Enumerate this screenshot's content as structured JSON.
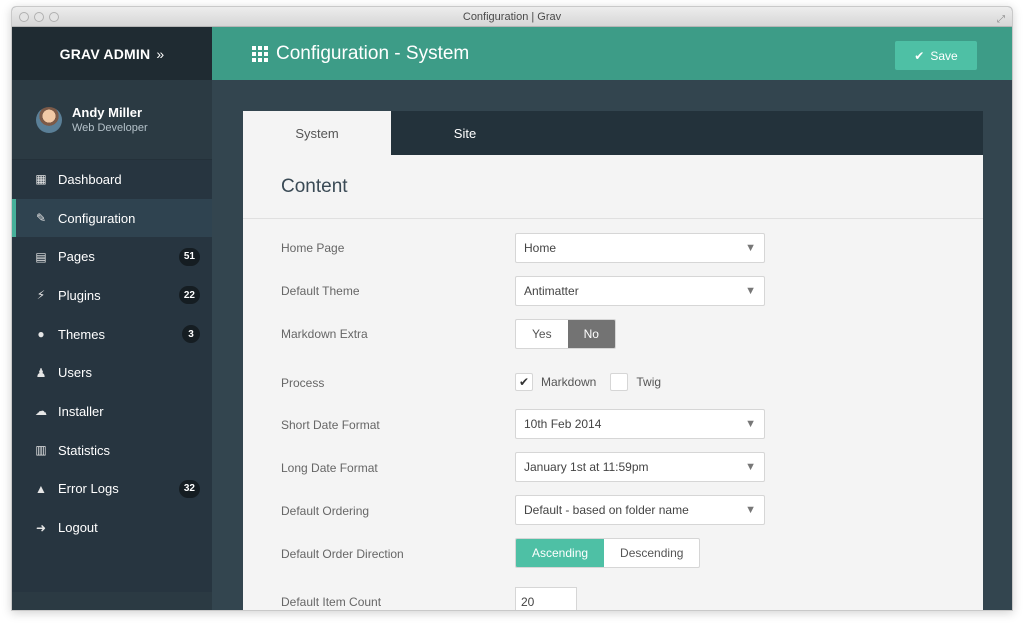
{
  "window": {
    "title": "Configuration | Grav"
  },
  "sidebar": {
    "brand": "GRAV ADMIN",
    "brand_chevron": "»",
    "user": {
      "name": "Andy Miller",
      "role": "Web Developer"
    },
    "items": [
      {
        "label": "Dashboard",
        "icon": "dashboard-grid-icon",
        "glyph": "▦",
        "badge": ""
      },
      {
        "label": "Configuration",
        "icon": "wrench-icon",
        "glyph": "✎",
        "badge": "",
        "active": true
      },
      {
        "label": "Pages",
        "icon": "file-icon",
        "glyph": "▤",
        "badge": "51"
      },
      {
        "label": "Plugins",
        "icon": "plug-icon",
        "glyph": "⚡",
        "badge": "22"
      },
      {
        "label": "Themes",
        "icon": "tint-icon",
        "glyph": "●",
        "badge": "3"
      },
      {
        "label": "Users",
        "icon": "user-icon",
        "glyph": "♟",
        "badge": ""
      },
      {
        "label": "Installer",
        "icon": "cloud-download-icon",
        "glyph": "☁",
        "badge": ""
      },
      {
        "label": "Statistics",
        "icon": "bar-chart-icon",
        "glyph": "▥",
        "badge": ""
      },
      {
        "label": "Error Logs",
        "icon": "warning-icon",
        "glyph": "▲",
        "badge": "32"
      },
      {
        "label": "Logout",
        "icon": "sign-out-icon",
        "glyph": "➜",
        "badge": ""
      }
    ]
  },
  "header": {
    "title": "Configuration - System",
    "save_label": "Save"
  },
  "tabs": [
    {
      "label": "System",
      "active": true
    },
    {
      "label": "Site",
      "active": false
    }
  ],
  "content": {
    "section_title": "Content",
    "home_page": {
      "label": "Home Page",
      "value": "Home"
    },
    "default_theme": {
      "label": "Default Theme",
      "value": "Antimatter"
    },
    "markdown_extra": {
      "label": "Markdown Extra",
      "yes": "Yes",
      "no": "No",
      "selected": "No"
    },
    "process": {
      "label": "Process",
      "markdown": "Markdown",
      "markdown_checked": true,
      "twig": "Twig",
      "twig_checked": false
    },
    "short_date": {
      "label": "Short Date Format",
      "value": "10th Feb 2014"
    },
    "long_date": {
      "label": "Long Date Format",
      "value": "January 1st at 11:59pm"
    },
    "ordering": {
      "label": "Default Ordering",
      "value": "Default - based on folder name"
    },
    "order_dir": {
      "label": "Default Order Direction",
      "asc": "Ascending",
      "desc": "Descending",
      "selected": "Ascending"
    },
    "item_count": {
      "label": "Default Item Count",
      "value": "20"
    }
  },
  "colors": {
    "accent": "#3d9c87",
    "sidebar": "#2b3a43",
    "save": "#4ec0a5"
  }
}
